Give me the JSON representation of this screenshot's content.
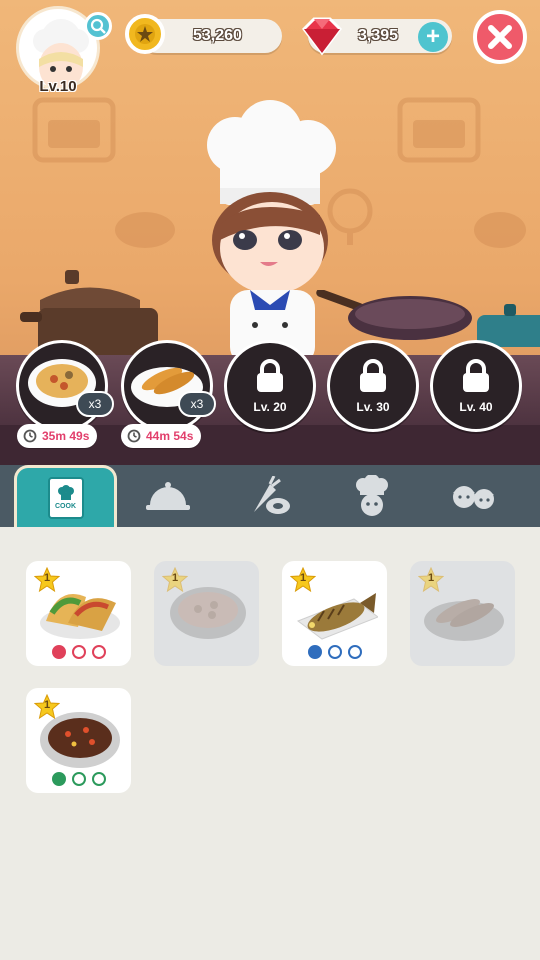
{
  "player": {
    "level_label": "Lv.10"
  },
  "currency": {
    "coins": "53,260",
    "gems": "3,395"
  },
  "stove_slots": [
    {
      "dish": "soup",
      "count_label": "x3",
      "timer": "35m 49s",
      "locked": false
    },
    {
      "dish": "fried-shrimp",
      "count_label": "x3",
      "timer": "44m 54s",
      "locked": false
    },
    {
      "locked": true,
      "level_label": "Lv. 20"
    },
    {
      "locked": true,
      "level_label": "Lv. 30"
    },
    {
      "locked": true,
      "level_label": "Lv. 40"
    }
  ],
  "tabs": [
    {
      "name": "cook",
      "label": "COOK",
      "icon": "recipe-book-icon",
      "active": true
    },
    {
      "name": "serving",
      "icon": "cloche-icon",
      "active": false
    },
    {
      "name": "ingredients",
      "icon": "ingredients-icon",
      "active": false
    },
    {
      "name": "chef",
      "icon": "chef-icon",
      "active": false
    },
    {
      "name": "staff",
      "icon": "staff-icon",
      "active": false
    }
  ],
  "recipes": [
    {
      "dish": "tacos",
      "star_level": "1",
      "available": true,
      "dot_color": "#e0415a",
      "filled_dots": 1
    },
    {
      "dish": "soup",
      "star_level": "1",
      "available": false,
      "dot_color": "#999999",
      "filled_dots": 0
    },
    {
      "dish": "grilled-fish",
      "star_level": "1",
      "available": true,
      "dot_color": "#2f6dbd",
      "filled_dots": 1
    },
    {
      "dish": "fried-shrimp",
      "star_level": "1",
      "available": false,
      "dot_color": "#999999",
      "filled_dots": 0
    },
    {
      "dish": "stew",
      "star_level": "1",
      "available": true,
      "dot_color": "#2c9a5c",
      "filled_dots": 1
    }
  ],
  "colors": {
    "accent_teal": "#2ea8a9",
    "close_red": "#ef5a6a",
    "timer_pink": "#e23f6c",
    "tabbar_slate": "#4b5a64"
  }
}
